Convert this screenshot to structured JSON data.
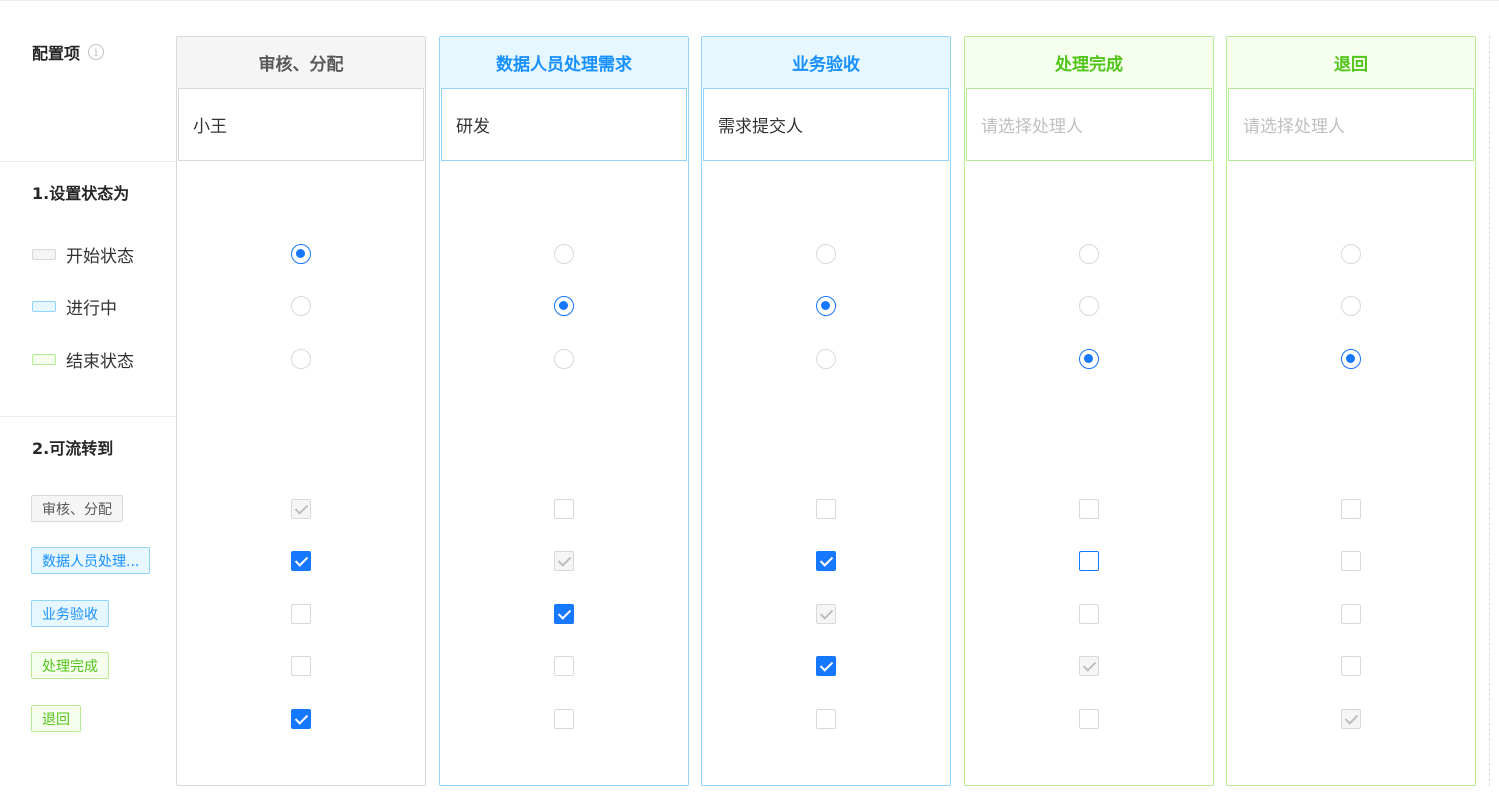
{
  "config": {
    "title": "配置项",
    "info_icon": "info-circle-icon",
    "section1_title": "1.设置状态为",
    "section2_title": "2.可流转到",
    "states": [
      {
        "label": "开始状态",
        "fill": "#f5f5f5",
        "border": "#d9d9d9"
      },
      {
        "label": "进行中",
        "fill": "#e6f7ff",
        "border": "#91d5ff"
      },
      {
        "label": "结束状态",
        "fill": "#f6ffed",
        "border": "#b7eb8f"
      }
    ],
    "transition_tags": [
      {
        "label": "审核、分配",
        "color": "#595959",
        "bg": "#f5f5f5",
        "border": "#d9d9d9"
      },
      {
        "label": "数据人员处理...",
        "color": "#1890ff",
        "bg": "#e6f7ff",
        "border": "#91d5ff"
      },
      {
        "label": "业务验收",
        "color": "#1890ff",
        "bg": "#e6f7ff",
        "border": "#91d5ff"
      },
      {
        "label": "处理完成",
        "color": "#52c41a",
        "bg": "#f6ffed",
        "border": "#b7eb8f"
      },
      {
        "label": "退回",
        "color": "#52c41a",
        "bg": "#f6ffed",
        "border": "#b7eb8f"
      }
    ]
  },
  "nodes": [
    {
      "name": "审核、分配",
      "head_color": "#595959",
      "head_bg": "#f5f5f5",
      "head_border": "#d9d9d9",
      "handler": "小王",
      "handler_placeholder": "",
      "state": 0,
      "transitions": [
        "disabled",
        "checked",
        "unchecked",
        "unchecked",
        "checked"
      ]
    },
    {
      "name": "数据人员处理需求",
      "head_color": "#1890ff",
      "head_bg": "#e6f7ff",
      "head_border": "#91d5ff",
      "handler": "研发",
      "handler_placeholder": "",
      "state": 1,
      "transitions": [
        "unchecked",
        "disabled",
        "checked",
        "unchecked",
        "unchecked"
      ]
    },
    {
      "name": "业务验收",
      "head_color": "#1890ff",
      "head_bg": "#e6f7ff",
      "head_border": "#91d5ff",
      "handler": "需求提交人",
      "handler_placeholder": "",
      "state": 1,
      "transitions": [
        "unchecked",
        "checked",
        "disabled",
        "checked",
        "unchecked"
      ]
    },
    {
      "name": "处理完成",
      "head_color": "#52c41a",
      "head_bg": "#f6ffed",
      "head_border": "#b7eb8f",
      "handler": "",
      "handler_placeholder": "请选择处理人",
      "state": 2,
      "transitions": [
        "unchecked",
        "focused",
        "unchecked",
        "disabled",
        "unchecked"
      ]
    },
    {
      "name": "退回",
      "head_color": "#52c41a",
      "head_bg": "#f6ffed",
      "head_border": "#b7eb8f",
      "handler": "",
      "handler_placeholder": "请选择处理人",
      "state": 2,
      "transitions": [
        "unchecked",
        "unchecked",
        "unchecked",
        "unchecked",
        "disabled"
      ]
    }
  ]
}
